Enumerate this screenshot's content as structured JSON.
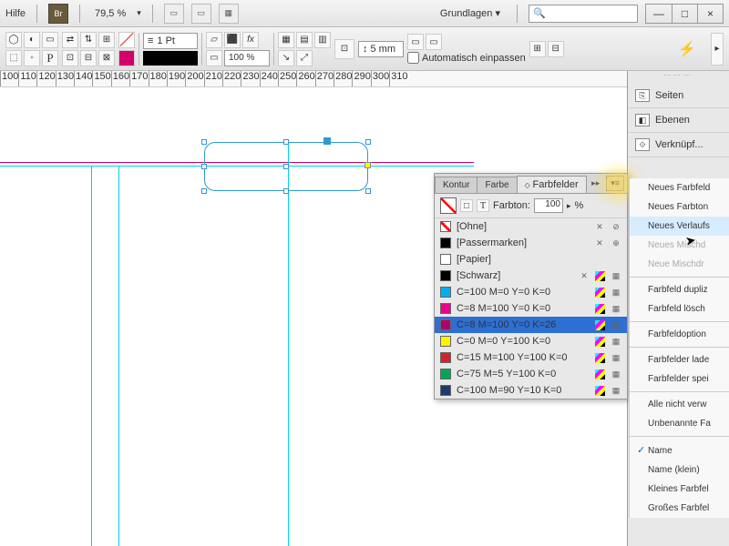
{
  "menubar": {
    "help": "Hilfe",
    "br": "Br",
    "zoom": "79,5 %",
    "workspace": "Grundlagen",
    "search_ph": "",
    "min": "—",
    "max": "□",
    "close": "×"
  },
  "toolbar": {
    "stroke_weight": "1 Pt",
    "pct": "100 %",
    "mm": "5 mm",
    "autofit": "Automatisch einpassen",
    "bolt": "⚡"
  },
  "ruler": {
    "ticks": [
      "100",
      "110",
      "120",
      "130",
      "140",
      "150",
      "160",
      "170",
      "180",
      "190",
      "200",
      "210",
      "220",
      "230",
      "240",
      "250",
      "260",
      "270",
      "280",
      "290",
      "300",
      "310"
    ]
  },
  "rail": {
    "items": [
      {
        "icon": "⎘",
        "label": "Seiten"
      },
      {
        "icon": "◧",
        "label": "Ebenen"
      },
      {
        "icon": "⟐",
        "label": "Verknüpf..."
      }
    ]
  },
  "swatchpanel": {
    "tabs": [
      "Kontur",
      "Farbe",
      "Farbfelder"
    ],
    "tint_label": "Farbton:",
    "tint_val": "100",
    "tint_unit": "%",
    "rows": [
      {
        "color": "none",
        "name": "[Ohne]",
        "lock": true,
        "noedit": true
      },
      {
        "color": "#000",
        "name": "[Passermarken]",
        "lock": true,
        "reg": true
      },
      {
        "color": "#fff",
        "name": "[Papier]"
      },
      {
        "color": "#000",
        "name": "[Schwarz]",
        "lock": true,
        "cmyk": true
      },
      {
        "color": "#00aeef",
        "name": "C=100 M=0 Y=0 K=0",
        "cmyk": true
      },
      {
        "color": "#ec008c",
        "name": "C=8 M=100 Y=0 K=0",
        "cmyk": true
      },
      {
        "color": "#b00070",
        "name": "C=8 M=100 Y=0 K=26",
        "cmyk": true,
        "sel": true
      },
      {
        "color": "#fff200",
        "name": "C=0 M=0 Y=100 K=0",
        "cmyk": true
      },
      {
        "color": "#d2232a",
        "name": "C=15 M=100 Y=100 K=0",
        "cmyk": true
      },
      {
        "color": "#00a651",
        "name": "C=75 M=5 Y=100 K=0",
        "cmyk": true
      },
      {
        "color": "#1b3c6a",
        "name": "C=100 M=90 Y=10 K=0",
        "cmyk": true
      }
    ]
  },
  "ctx": {
    "items": [
      {
        "t": "Neues Farbfeld"
      },
      {
        "t": "Neues Farbton"
      },
      {
        "t": "Neues Verlaufs",
        "hov": true
      },
      {
        "t": "Neues Mischd",
        "dis": true
      },
      {
        "t": "Neue Mischdr",
        "dis": true
      },
      {
        "sep": true
      },
      {
        "t": "Farbfeld dupliz"
      },
      {
        "t": "Farbfeld lösch"
      },
      {
        "sep": true
      },
      {
        "t": "Farbfeldoption"
      },
      {
        "sep": true
      },
      {
        "t": "Farbfelder lade"
      },
      {
        "t": "Farbfelder spei"
      },
      {
        "sep": true
      },
      {
        "t": "Alle nicht verw"
      },
      {
        "t": "Unbenannte Fa"
      },
      {
        "sep": true
      },
      {
        "t": "Name",
        "chk": true
      },
      {
        "t": "Name (klein)"
      },
      {
        "t": "Kleines Farbfel"
      },
      {
        "t": "Großes Farbfel"
      }
    ]
  }
}
